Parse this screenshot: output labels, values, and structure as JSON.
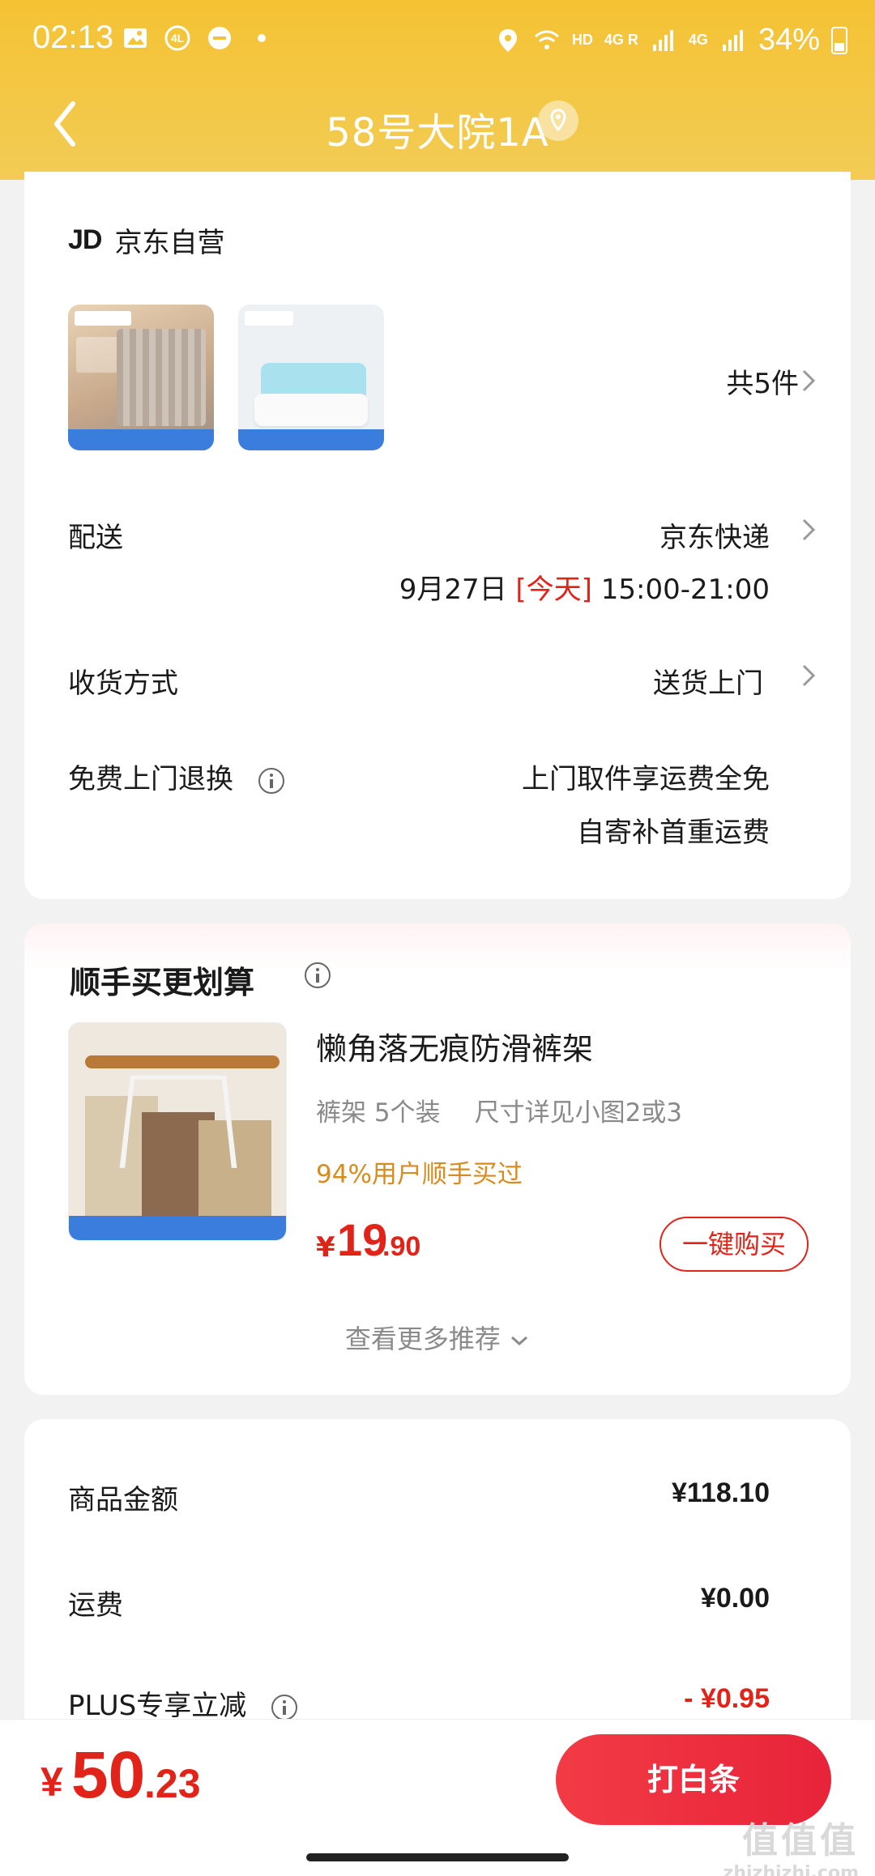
{
  "status_bar": {
    "time": "02:13",
    "network": "HD",
    "net1": "4G R",
    "net2": "4G",
    "battery": "34%"
  },
  "nav": {
    "title": "58号大院1A"
  },
  "shop": {
    "logo": "JD",
    "name": "京东自营"
  },
  "items": {
    "count_label": "共5件"
  },
  "delivery": {
    "label": "配送",
    "carrier": "京东快递",
    "date": "9月27日",
    "today": "[今天]",
    "window": "15:00-21:00"
  },
  "receive": {
    "label": "收货方式",
    "value": "送货上门"
  },
  "returns": {
    "label": "免费上门退换",
    "line1": "上门取件享运费全免",
    "line2": "自寄补首重运费"
  },
  "recommend": {
    "title": "顺手买更划算",
    "product_name": "懒角落无痕防滑裤架",
    "spec1": "裤架 5个装",
    "spec2": "尺寸详见小图2或3",
    "hint": "94%用户顺手买过",
    "price_symbol": "¥",
    "price_int": "19",
    "price_dec": ".90",
    "buy_label": "一键购买",
    "more_label": "查看更多推荐"
  },
  "summary": {
    "goods_label": "商品金额",
    "goods_value": "¥118.10",
    "shipping_label": "运费",
    "shipping_value": "¥0.00",
    "plus_label": "PLUS专享立减",
    "plus_value": "- ¥0.95"
  },
  "footer": {
    "total_symbol": "¥",
    "total_int": "50",
    "total_dec": ".23",
    "pay_label": "打白条"
  },
  "watermark": {
    "text": "值值值",
    "site": "zhizhizhi.com"
  },
  "colors": {
    "brand_yellow": "#f5c233",
    "accent_red": "#e2231a",
    "hint_orange": "#d98b1e"
  }
}
